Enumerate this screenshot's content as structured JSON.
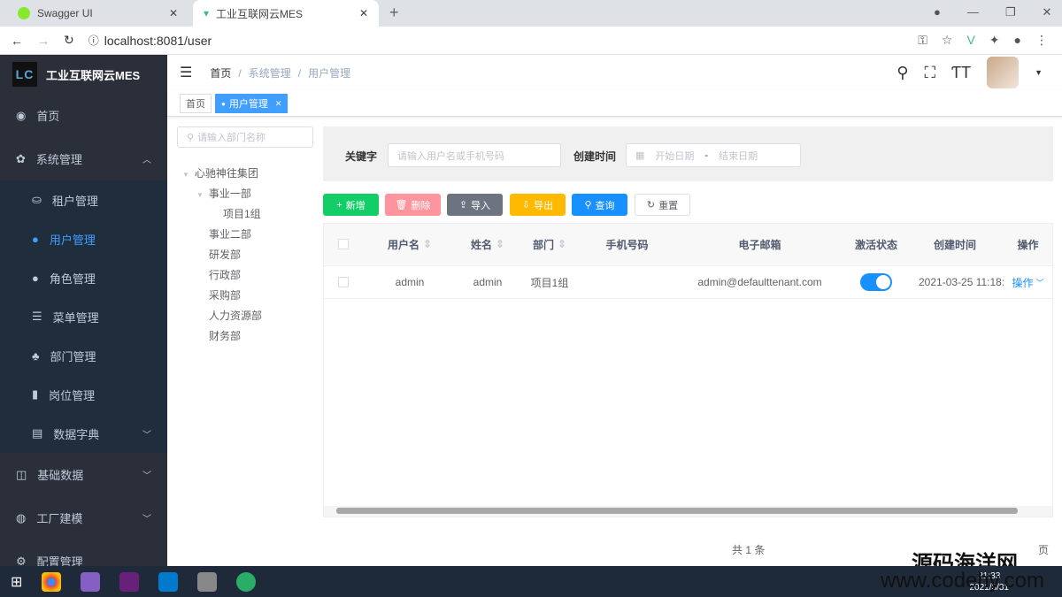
{
  "browser": {
    "tabs": [
      {
        "title": "Swagger UI"
      },
      {
        "title": "工业互联网云MES"
      }
    ],
    "url": "localhost:8081/user"
  },
  "sidebar": {
    "logo_mark": "LC",
    "app_title": "工业互联网云MES",
    "items": [
      {
        "label": "首页",
        "icon": "dashboard-icon"
      },
      {
        "label": "系统管理",
        "icon": "gear-icon"
      },
      {
        "label": "租户管理",
        "icon": "tenant-icon"
      },
      {
        "label": "用户管理",
        "icon": "user-icon"
      },
      {
        "label": "角色管理",
        "icon": "role-icon"
      },
      {
        "label": "菜单管理",
        "icon": "menu-icon"
      },
      {
        "label": "部门管理",
        "icon": "tree-icon"
      },
      {
        "label": "岗位管理",
        "icon": "post-icon"
      },
      {
        "label": "数据字典",
        "icon": "dict-icon"
      },
      {
        "label": "基础数据",
        "icon": "book-icon"
      },
      {
        "label": "工厂建模",
        "icon": "globe-icon"
      },
      {
        "label": "配置管理",
        "icon": "config-icon"
      }
    ]
  },
  "breadcrumb": [
    "首页",
    "系统管理",
    "用户管理"
  ],
  "tags": [
    {
      "label": "首页"
    },
    {
      "label": "用户管理"
    }
  ],
  "dept_tree": {
    "placeholder": "请输入部门名称",
    "nodes": [
      "心驰神往集团",
      "事业一部",
      "项目1组",
      "事业二部",
      "研发部",
      "行政部",
      "采购部",
      "人力资源部",
      "财务部"
    ]
  },
  "search": {
    "keyword_label": "关键字",
    "keyword_placeholder": "请输入用户名或手机号码",
    "date_label": "创建时间",
    "start_placeholder": "开始日期",
    "sep": "-",
    "end_placeholder": "结束日期"
  },
  "toolbar": {
    "add": "新增",
    "delete": "删除",
    "import": "导入",
    "export": "导出",
    "query": "查询",
    "reset": "重置"
  },
  "table": {
    "columns": [
      "用户名",
      "姓名",
      "部门",
      "手机号码",
      "电子邮箱",
      "激活状态",
      "创建时间",
      "操作"
    ],
    "rows": [
      {
        "username": "admin",
        "name": "admin",
        "dept": "项目1组",
        "phone": "",
        "email": "admin@defaulttenant.com",
        "active": true,
        "created": "2021-03-25 11:18:",
        "action": "操作"
      }
    ]
  },
  "pagination": {
    "total": "共 1 条",
    "page_suffix": "页"
  },
  "taskbar": {
    "time": "21:33",
    "date": "2021/3/31"
  },
  "watermark": {
    "text": "源码海洋网",
    "url": "www.codehy.com"
  },
  "colors": {
    "primary": "#409eff",
    "success": "#13ce66",
    "danger": "#ff949e",
    "info": "#6d7480",
    "warning": "#ffba00",
    "sidebar": "#2b2f3a"
  }
}
